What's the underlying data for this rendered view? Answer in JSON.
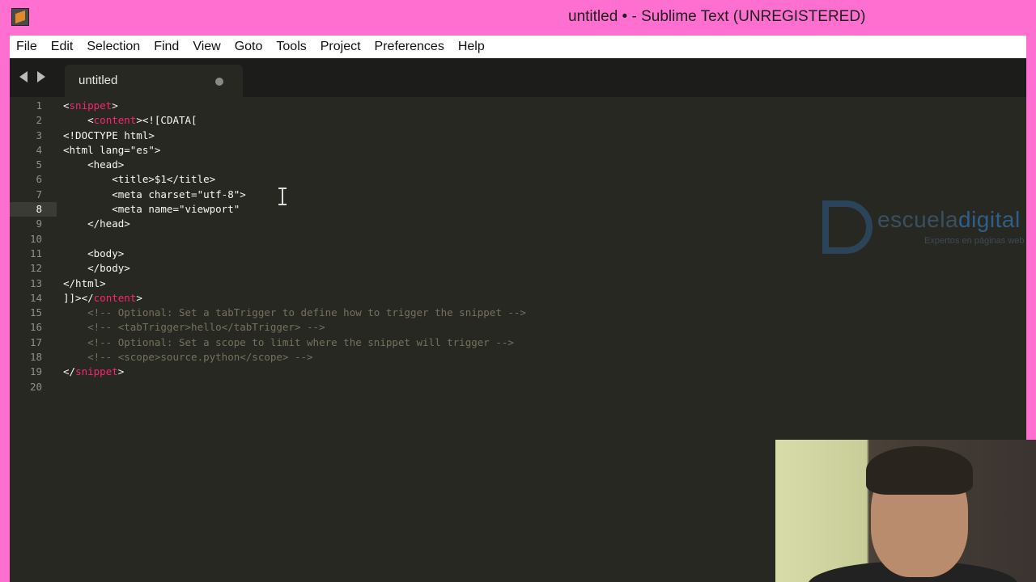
{
  "window": {
    "title": "untitled • - Sublime Text (UNREGISTERED)"
  },
  "menu": [
    "File",
    "Edit",
    "Selection",
    "Find",
    "View",
    "Goto",
    "Tools",
    "Project",
    "Preferences",
    "Help"
  ],
  "tab": {
    "label": "untitled",
    "modified": true
  },
  "editor": {
    "active_line": 8,
    "line_numbers": [
      "1",
      "2",
      "3",
      "4",
      "5",
      "6",
      "7",
      "8",
      "9",
      "10",
      "11",
      "12",
      "13",
      "14",
      "15",
      "16",
      "17",
      "18",
      "19",
      "20"
    ],
    "lines": [
      [
        [
          "t",
          "<"
        ],
        [
          "k",
          "snippet"
        ],
        [
          "t",
          ">"
        ]
      ],
      [
        [
          "t",
          "    <"
        ],
        [
          "k",
          "content"
        ],
        [
          "t",
          "><![CDATA["
        ]
      ],
      [
        [
          "t",
          "<!DOCTYPE html>"
        ]
      ],
      [
        [
          "t",
          "<html lang=\"es\">"
        ]
      ],
      [
        [
          "t",
          "    <head>"
        ]
      ],
      [
        [
          "t",
          "        <title>$1</title>"
        ]
      ],
      [
        [
          "t",
          "        <meta charset=\"utf-8\">"
        ]
      ],
      [
        [
          "t",
          "        <meta name=\"viewport\""
        ]
      ],
      [
        [
          "t",
          "    </head>"
        ]
      ],
      [
        [
          "t",
          ""
        ]
      ],
      [
        [
          "t",
          "    <body>"
        ]
      ],
      [
        [
          "t",
          "    </body>"
        ]
      ],
      [
        [
          "t",
          "</html>"
        ]
      ],
      [
        [
          "t",
          "]]></"
        ],
        [
          "k",
          "content"
        ],
        [
          "t",
          ">"
        ]
      ],
      [
        [
          "c",
          "    <!-- Optional: Set a tabTrigger to define how to trigger the snippet -->"
        ]
      ],
      [
        [
          "c",
          "    <!-- <tabTrigger>hello</tabTrigger> -->"
        ]
      ],
      [
        [
          "c",
          "    <!-- Optional: Set a scope to limit where the snippet will trigger -->"
        ]
      ],
      [
        [
          "c",
          "    <!-- <scope>source.python</scope> -->"
        ]
      ],
      [
        [
          "t",
          "</"
        ],
        [
          "k",
          "snippet"
        ],
        [
          "t",
          ">"
        ]
      ],
      [
        [
          "t",
          ""
        ]
      ]
    ]
  },
  "watermark": {
    "brand_1": "escuela",
    "brand_2": "digital",
    "tagline": "Expertos en páginas web"
  },
  "colors": {
    "titlebar": "#ff6fd0",
    "editor_bg": "#272822",
    "keyword": "#f92672",
    "comment": "#75715e",
    "text": "#f8f8f2"
  }
}
